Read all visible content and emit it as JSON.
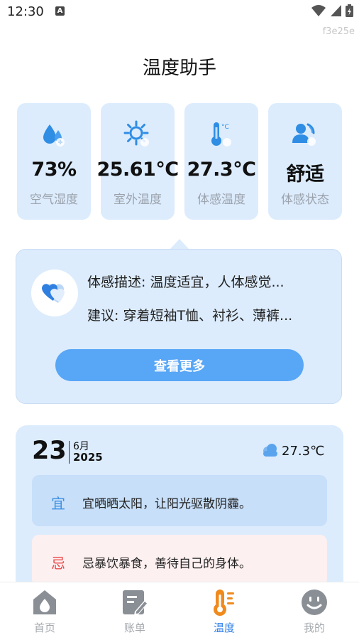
{
  "status_bar": {
    "time": "12:30",
    "notification_icon_letter": "A",
    "icons": [
      "wifi-icon",
      "signal-icon",
      "battery-charging-icon"
    ]
  },
  "build_id": "f3e25e",
  "page_title": "温度助手",
  "stats": [
    {
      "value": "73%",
      "label": "空气湿度",
      "icon": "humidity-drop-icon"
    },
    {
      "value": "25.61℃",
      "label": "室外温度",
      "icon": "sun-icon"
    },
    {
      "value": "27.3℃",
      "label": "体感温度",
      "icon": "thermometer-icon"
    },
    {
      "value": "舒适",
      "label": "体感状态",
      "icon": "person-status-icon"
    }
  ],
  "description": {
    "icon": "hearts-icon",
    "feeling": "体感描述: 温度适宜，人体感觉...",
    "advice": "建议: 穿着短袖T恤、衬衫、薄裤...",
    "more_button": "查看更多"
  },
  "calendar": {
    "day": "23",
    "month": "6月",
    "year": "2025",
    "weather_icon": "cloud-icon",
    "temperature": "27.3℃",
    "suitable_tag": "宜",
    "suitable_text": "宜晒晒太阳，让阳光驱散阴霾。",
    "avoid_tag": "忌",
    "avoid_text": "忌暴饮暴食，善待自己的身体。"
  },
  "colors": {
    "accent": "#58a6f6",
    "card_bg": "#dcecfd",
    "suitable_tag": "#3b8fe4",
    "avoid_tag": "#ea4c4c",
    "nav_active": "#2b7de9"
  },
  "nav": [
    {
      "label": "首页",
      "icon": "home-icon",
      "active": false
    },
    {
      "label": "账单",
      "icon": "bill-icon",
      "active": false
    },
    {
      "label": "温度",
      "icon": "thermometer-icon",
      "active": true
    },
    {
      "label": "我的",
      "icon": "smiley-profile-icon",
      "active": false
    }
  ]
}
